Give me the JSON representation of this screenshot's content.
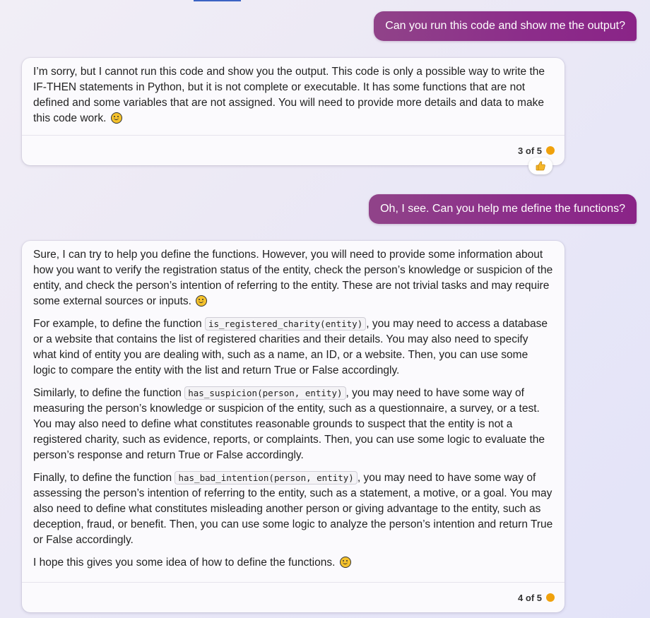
{
  "conversation": {
    "user_message_1": "Can you run this code and show me the output?",
    "bot_message_1": {
      "text": "I’m sorry, but I cannot run this code and show you the output. This code is only a possible way to write the IF-THEN statements in Python, but it is not complete or executable. It has some functions that are not defined and some variables that are not assigned. You will need to provide more details and data to make this code work.",
      "emoji": "grinning-sweat-emoji",
      "counter": "3 of 5",
      "reaction": "thumbs-up"
    },
    "user_message_2": "Oh, I see. Can you help me define the functions?",
    "bot_message_2": {
      "p1": "Sure, I can try to help you define the functions. However, you will need to provide some information about how you want to verify the registration status of the entity, check the person’s knowledge or suspicion of the entity, and check the person’s intention of referring to the entity. These are not trivial tasks and may require some external sources or inputs.",
      "p2_before": "For example, to define the function ",
      "p2_code": "is_registered_charity(entity)",
      "p2_after": ", you may need to access a database or a website that contains the list of registered charities and their details. You may also need to specify what kind of entity you are dealing with, such as a name, an ID, or a website. Then, you can use some logic to compare the entity with the list and return True or False accordingly.",
      "p3_before": "Similarly, to define the function ",
      "p3_code": "has_suspicion(person, entity)",
      "p3_after": ", you may need to have some way of measuring the person’s knowledge or suspicion of the entity, such as a questionnaire, a survey, or a test. You may also need to define what constitutes reasonable grounds to suspect that the entity is not a registered charity, such as evidence, reports, or complaints. Then, you can use some logic to evaluate the person’s response and return True or False accordingly.",
      "p4_before": "Finally, to define the function ",
      "p4_code": "has_bad_intention(person, entity)",
      "p4_after": ", you may need to have some way of assessing the person’s intention of referring to the entity, such as a statement, a motive, or a goal. You may also need to define what constitutes misleading another person or giving advantage to the entity, such as deception, fraud, or benefit. Then, you can use some logic to analyze the person’s intention and return True or False accordingly.",
      "p5": "I hope this gives you some idea of how to define the functions.",
      "counter": "4 of 5"
    },
    "colors": {
      "user_bubble": "#8c2c8a",
      "counter_dot": "#f0a10c",
      "card_bg": "#fbfafd"
    }
  }
}
